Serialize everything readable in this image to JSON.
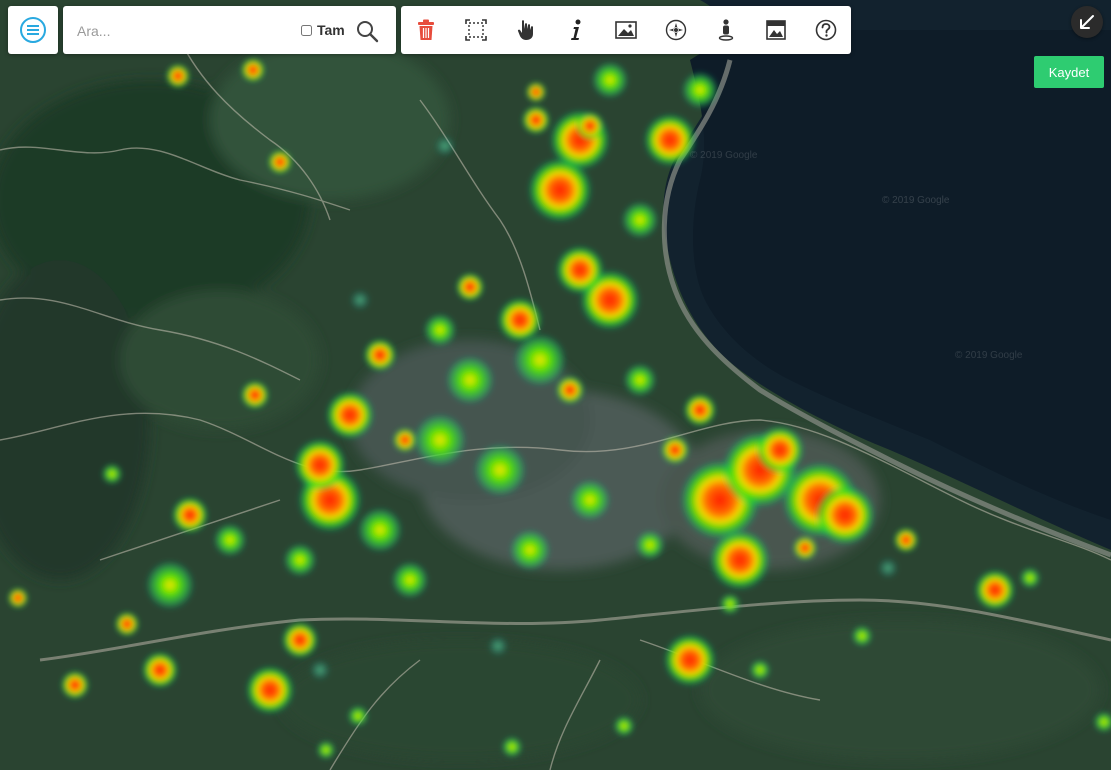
{
  "search": {
    "placeholder": "Ara...",
    "exact_label": "Tam",
    "exact_checked": false
  },
  "toolbar": {
    "tools": [
      "delete-icon",
      "select-area-icon",
      "pan-hand-icon",
      "info-icon",
      "image-icon",
      "compass-icon",
      "street-view-icon",
      "photo-gallery-icon",
      "help-icon"
    ],
    "accent": "#e74c3c"
  },
  "actions": {
    "save_label": "Kaydet",
    "save_color": "#2ecc71"
  },
  "map": {
    "layer": "satellite-heatmap",
    "attribution": [
      "© 2019 Google",
      "© 2019 Google",
      "© 2019 Google"
    ],
    "heatmap_colors": [
      "#00ff00",
      "#ffff00",
      "#ff7f00",
      "#ff0000"
    ]
  }
}
